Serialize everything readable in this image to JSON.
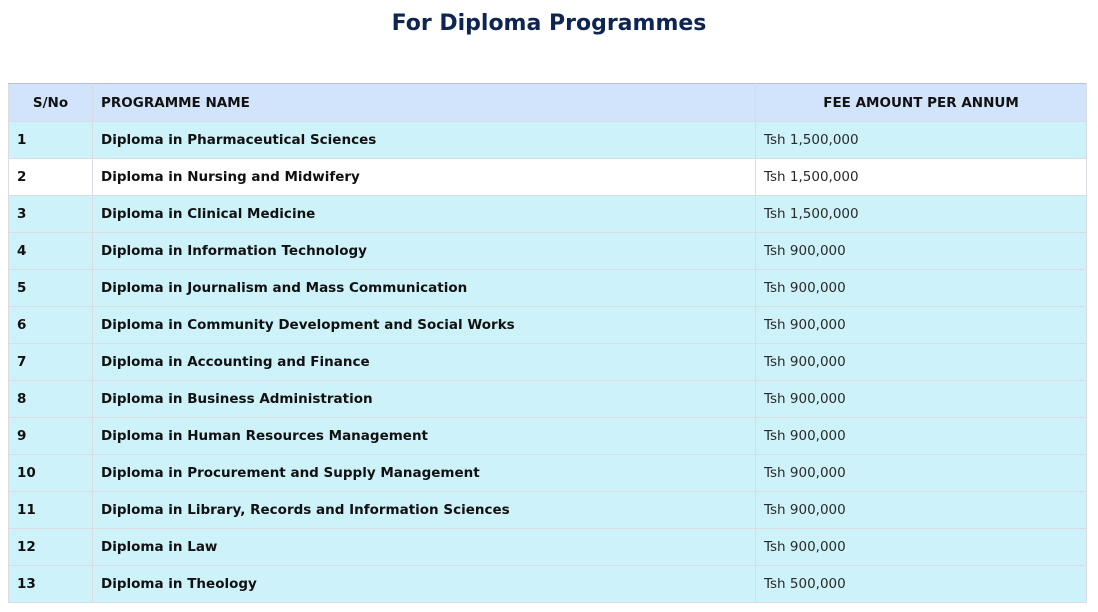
{
  "page": {
    "title": "For Diploma Programmes"
  },
  "table": {
    "headers": {
      "sn": "S/No",
      "programme": "PROGRAMME NAME",
      "fee": "FEE AMOUNT PER ANNUM"
    },
    "rows": [
      {
        "sn": "1",
        "programme": "Diploma in Pharmaceutical Sciences",
        "fee": "Tsh 1,500,000"
      },
      {
        "sn": "2",
        "programme": "Diploma in Nursing and Midwifery",
        "fee": "Tsh 1,500,000"
      },
      {
        "sn": "3",
        "programme": "Diploma in Clinical Medicine",
        "fee": "Tsh 1,500,000"
      },
      {
        "sn": "4",
        "programme": "Diploma in Information Technology",
        "fee": "Tsh 900,000"
      },
      {
        "sn": "5",
        "programme": "Diploma in Journalism and Mass Communication",
        "fee": "Tsh 900,000"
      },
      {
        "sn": "6",
        "programme": "Diploma in Community Development and Social Works",
        "fee": "Tsh 900,000"
      },
      {
        "sn": "7",
        "programme": "Diploma in Accounting and Finance",
        "fee": "Tsh 900,000"
      },
      {
        "sn": "8",
        "programme": "Diploma in Business Administration",
        "fee": "Tsh 900,000"
      },
      {
        "sn": "9",
        "programme": "Diploma in Human Resources Management",
        "fee": "Tsh 900,000"
      },
      {
        "sn": "10",
        "programme": "Diploma in Procurement and Supply Management",
        "fee": "Tsh 900,000"
      },
      {
        "sn": "11",
        "programme": "Diploma in Library, Records and Information Sciences",
        "fee": "Tsh 900,000"
      },
      {
        "sn": "12",
        "programme": "Diploma in Law",
        "fee": "Tsh 900,000"
      },
      {
        "sn": "13",
        "programme": "Diploma in Theology",
        "fee": "Tsh 500,000"
      }
    ]
  },
  "colors": {
    "title": "#0d2550",
    "header_bg": "#d1e4fc",
    "row_bg": "#cdf2f9",
    "row_highlight_bg": "#ffffff"
  }
}
